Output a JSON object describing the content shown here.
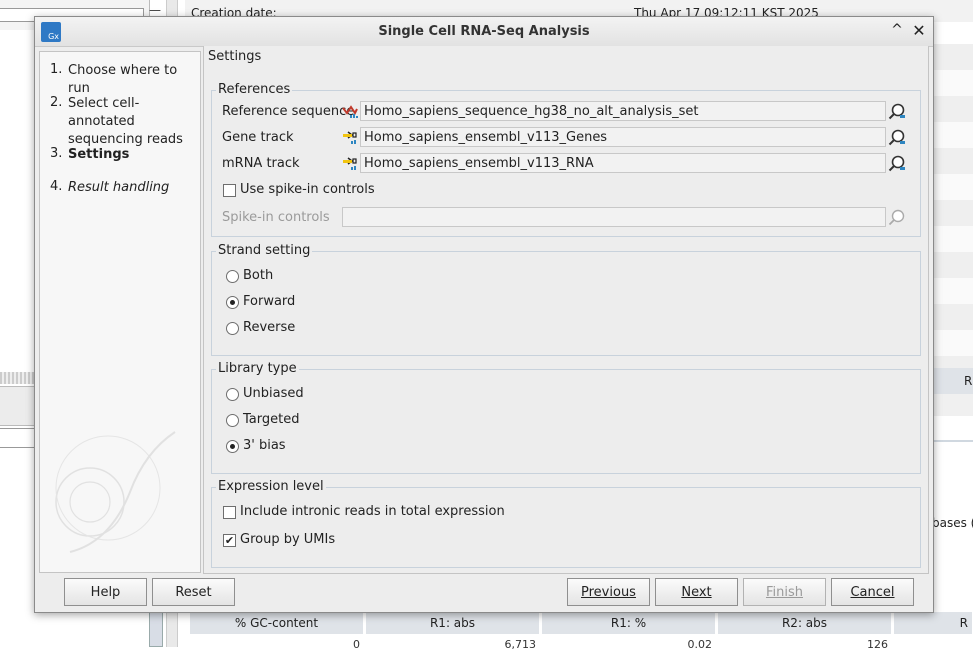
{
  "background": {
    "creation_label": "Creation date:",
    "creation_value": "Thu Apr 17 09:12:11 KST 2025",
    "right_letter": "R",
    "bases_text": "bases (",
    "minus_glyph": "—",
    "table": {
      "headers": [
        "% GC-content",
        "R1: abs",
        "R1: %",
        "R2: abs",
        "R"
      ],
      "values": [
        "0",
        "6,713",
        "0.02",
        "126"
      ]
    }
  },
  "dialog": {
    "title": "Single Cell RNA-Seq Analysis",
    "logo_text": "Gx",
    "collapse_glyph": "^",
    "close_glyph": "✕"
  },
  "steps": [
    {
      "num": "1.",
      "label": "Choose where to run"
    },
    {
      "num": "2.",
      "label": "Select cell-annotated sequencing reads"
    },
    {
      "num": "3.",
      "label": "Settings"
    },
    {
      "num": "4.",
      "label": "Result handling"
    }
  ],
  "settings": {
    "title": "Settings",
    "references": {
      "legend": "References",
      "reference_sequence": {
        "label": "Reference sequence",
        "value": "Homo_sapiens_sequence_hg38_no_alt_analysis_set",
        "icon": "sequence-track-icon"
      },
      "gene_track": {
        "label": "Gene track",
        "value": "Homo_sapiens_ensembl_v113_Genes",
        "icon": "annotation-track-icon"
      },
      "mrna_track": {
        "label": "mRNA track",
        "value": "Homo_sapiens_ensembl_v113_RNA",
        "icon": "annotation-track-icon"
      },
      "use_spike_in": {
        "label": "Use spike-in controls",
        "checked": false
      },
      "spike_in_controls": {
        "label": "Spike-in controls",
        "value": "",
        "enabled": false
      }
    },
    "strand": {
      "legend": "Strand setting",
      "options": [
        "Both",
        "Forward",
        "Reverse"
      ],
      "selected": "Forward"
    },
    "library": {
      "legend": "Library type",
      "options": [
        "Unbiased",
        "Targeted",
        "3' bias"
      ],
      "selected": "3' bias"
    },
    "expression": {
      "legend": "Expression level",
      "intronic": {
        "label": "Include intronic reads in total expression",
        "checked": false
      },
      "umis": {
        "label": "Group by UMIs",
        "checked": true
      }
    }
  },
  "buttons": {
    "help": "Help",
    "reset": "Reset",
    "previous": "Previous",
    "next": "Next",
    "finish": "Finish",
    "cancel": "Cancel"
  },
  "colors": {
    "logo": "#2f79c5",
    "group_border": "#c8d2dc",
    "dialog_bg": "#ededed"
  }
}
